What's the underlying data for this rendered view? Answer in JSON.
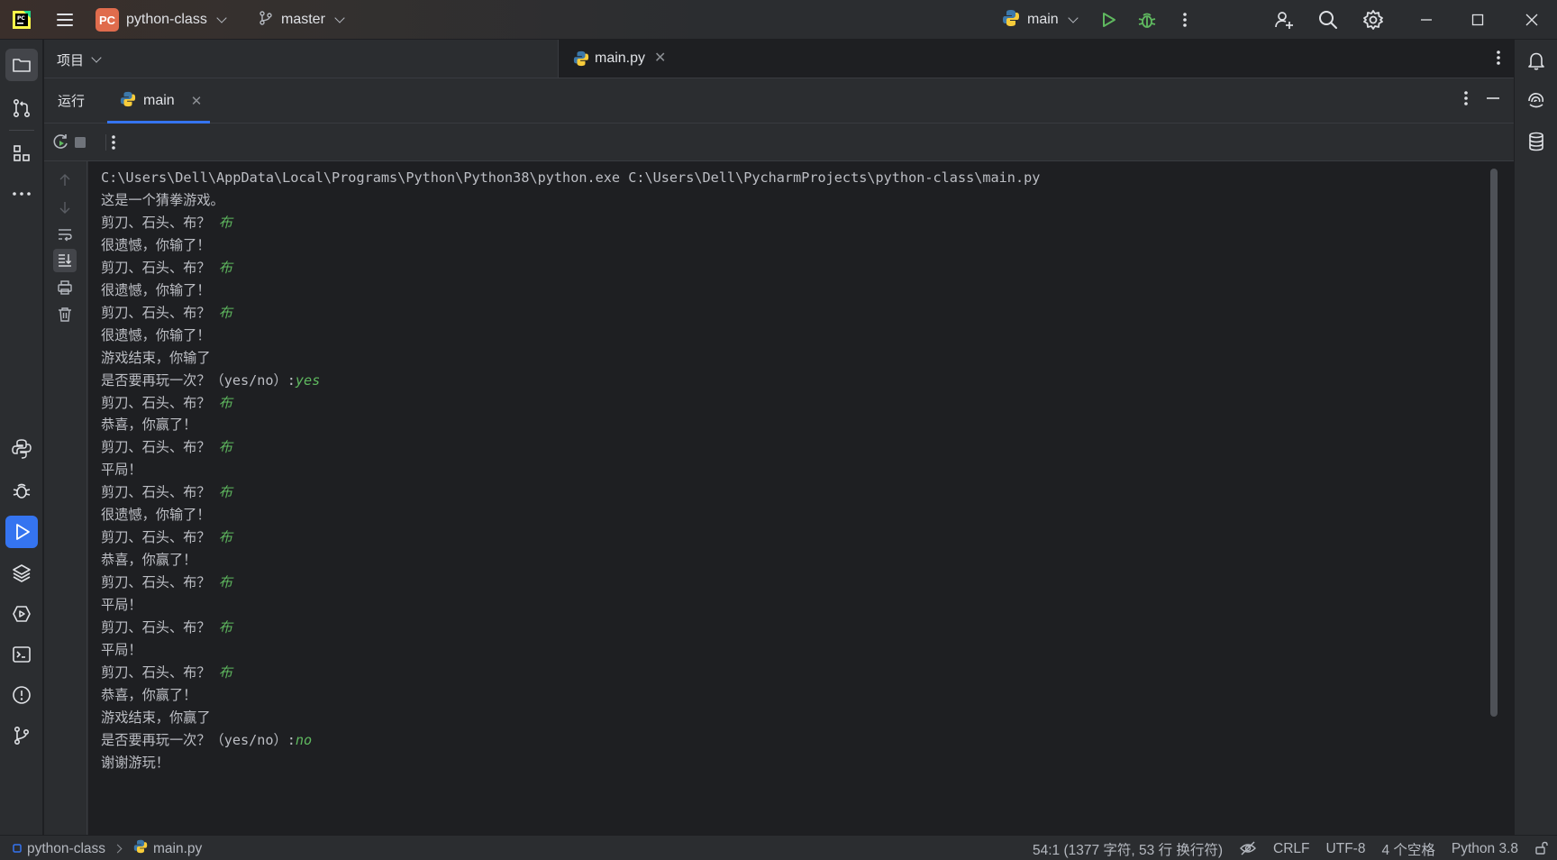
{
  "titlebar": {
    "project_badge": "PC",
    "project_name": "python-class",
    "branch": "master",
    "run_config": "main"
  },
  "project_panel": {
    "title": "项目"
  },
  "editor": {
    "tabs": [
      {
        "label": "main.py",
        "active": true
      }
    ]
  },
  "run_panel": {
    "label": "运行",
    "tab": "main"
  },
  "console": {
    "lines": [
      {
        "text": "C:\\Users\\Dell\\AppData\\Local\\Programs\\Python\\Python38\\python.exe C:\\Users\\Dell\\PycharmProjects\\python-class\\main.py",
        "input": ""
      },
      {
        "text": "这是一个猜拳游戏。",
        "input": ""
      },
      {
        "text": "剪刀、石头、布？ ",
        "input": "布"
      },
      {
        "text": "很遗憾，你输了！",
        "input": ""
      },
      {
        "text": "剪刀、石头、布？ ",
        "input": "布"
      },
      {
        "text": "很遗憾，你输了！",
        "input": ""
      },
      {
        "text": "剪刀、石头、布？ ",
        "input": "布"
      },
      {
        "text": "很遗憾，你输了！",
        "input": ""
      },
      {
        "text": "游戏结束，你输了",
        "input": ""
      },
      {
        "text": "是否要再玩一次？（yes/no）:",
        "input": "yes"
      },
      {
        "text": "剪刀、石头、布？ ",
        "input": "布"
      },
      {
        "text": "恭喜，你赢了！",
        "input": ""
      },
      {
        "text": "剪刀、石头、布？ ",
        "input": "布"
      },
      {
        "text": "平局！",
        "input": ""
      },
      {
        "text": "剪刀、石头、布？ ",
        "input": "布"
      },
      {
        "text": "很遗憾，你输了！",
        "input": ""
      },
      {
        "text": "剪刀、石头、布？ ",
        "input": "布"
      },
      {
        "text": "恭喜，你赢了！",
        "input": ""
      },
      {
        "text": "剪刀、石头、布？ ",
        "input": "布"
      },
      {
        "text": "平局！",
        "input": ""
      },
      {
        "text": "剪刀、石头、布？ ",
        "input": "布"
      },
      {
        "text": "平局！",
        "input": ""
      },
      {
        "text": "剪刀、石头、布？ ",
        "input": "布"
      },
      {
        "text": "恭喜，你赢了！",
        "input": ""
      },
      {
        "text": "游戏结束，你赢了",
        "input": ""
      },
      {
        "text": "是否要再玩一次？（yes/no）:",
        "input": "no"
      },
      {
        "text": "谢谢游玩！",
        "input": ""
      }
    ]
  },
  "statusbar": {
    "project": "python-class",
    "file": "main.py",
    "position": "54:1 (1377 字符, 53 行 换行符)",
    "line_separator": "CRLF",
    "encoding": "UTF-8",
    "indent": "4 个空格",
    "interpreter": "Python 3.8"
  },
  "colors": {
    "accent": "#3574f0",
    "user_input": "#5fb85f",
    "project_badge": "#e06c4d",
    "run_green": "#5fb85f"
  }
}
